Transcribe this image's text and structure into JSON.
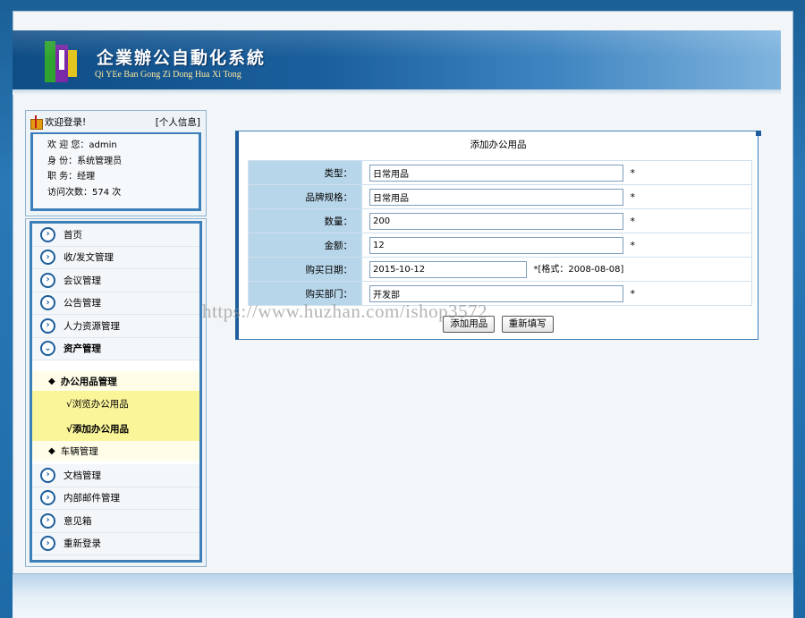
{
  "window": {
    "controls": [
      "minimize-icon",
      "maximize-icon",
      "close-icon"
    ]
  },
  "header": {
    "title": "企業辦公自動化系統",
    "subtitle": "Qi YEe Ban Gong Zi Dong Hua Xi Tong"
  },
  "welcome": {
    "greeting": "欢迎登录!",
    "profile_link": "[个人信息]",
    "user_line": "欢 迎 您：admin",
    "identity_line": "身    份：系统管理员",
    "position_line": "职    务：经理",
    "visits_line": "访问次数：574 次"
  },
  "menu": {
    "items_top": [
      {
        "label": "首页"
      },
      {
        "label": "收/发文管理"
      },
      {
        "label": "会议管理"
      },
      {
        "label": "公告管理"
      },
      {
        "label": "人力资源管理"
      },
      {
        "label": "资产管理"
      }
    ],
    "submenu": {
      "category_1": "办公用品管理",
      "link_1": "√浏览办公用品",
      "link_2": "√添加办公用品",
      "category_2": "车辆管理"
    },
    "items_bottom": [
      {
        "label": "文档管理"
      },
      {
        "label": "内部邮件管理"
      },
      {
        "label": "意见箱"
      },
      {
        "label": "重新登录"
      }
    ]
  },
  "form": {
    "title": "添加办公用品",
    "fields": [
      {
        "label": "类型：",
        "value": "日常用品"
      },
      {
        "label": "品牌规格：",
        "value": "日常用品"
      },
      {
        "label": "数量：",
        "value": "200"
      },
      {
        "label": "金额：",
        "value": "12"
      },
      {
        "label": "购买日期：",
        "value": "2015-10-12"
      },
      {
        "label": "购买部门：",
        "value": "开发部"
      }
    ],
    "required_mark": "*",
    "date_hint": "*[格式：2008-08-08]",
    "submit_label": "添加用品",
    "reset_label": "重新填写"
  },
  "watermark": "https://www.huzhan.com/ishop3572"
}
